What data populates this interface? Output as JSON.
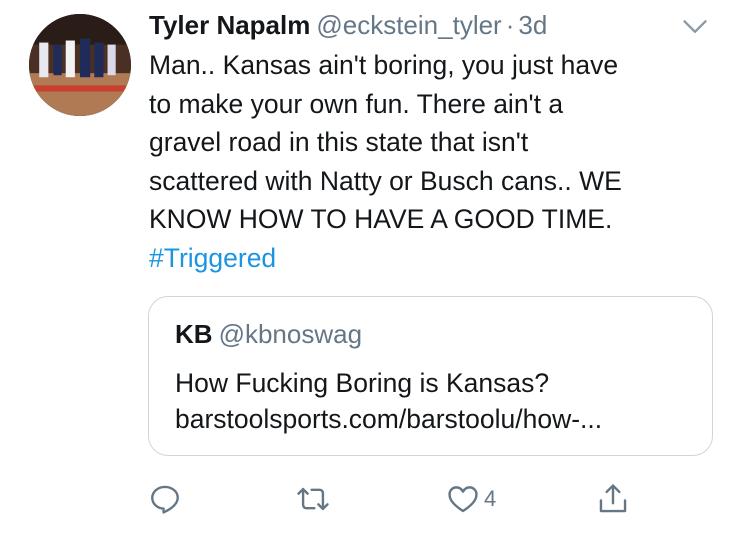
{
  "tweet": {
    "author": {
      "display_name": "Tyler Napalm",
      "handle": "@eckstein_tyler",
      "avatar_icon": "avatar-photo-basketball-players"
    },
    "separator": "·",
    "time": "3d",
    "text_lines": [
      "Man.. Kansas ain't boring, you just have",
      "to make your own fun. There ain't a",
      "gravel road in this state that isn't",
      "scattered with Natty or Busch cans.. WE",
      "KNOW HOW TO HAVE A GOOD TIME."
    ],
    "hashtag": "#Triggered",
    "menu_icon": "chevron-down-icon"
  },
  "quote": {
    "display_name": "KB",
    "handle": "@kbnoswag",
    "text_lines": [
      "How Fucking Boring is Kansas?",
      "barstoolsports.com/barstoolu/how-..."
    ]
  },
  "actions": {
    "reply": {
      "icon": "reply-icon",
      "count": ""
    },
    "retweet": {
      "icon": "retweet-icon",
      "count": ""
    },
    "like": {
      "icon": "heart-icon",
      "count": "4"
    },
    "share": {
      "icon": "share-icon",
      "count": ""
    }
  },
  "colors": {
    "text": "#14171a",
    "secondary": "#657786",
    "link": "#1b95e0",
    "border": "#ccd6dd"
  }
}
